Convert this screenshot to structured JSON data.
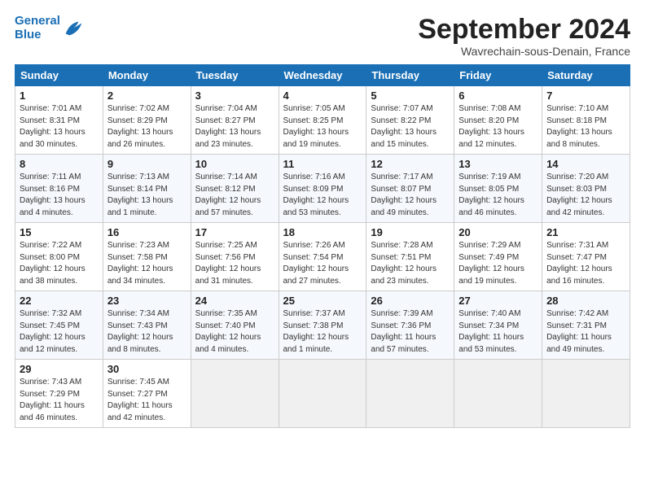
{
  "header": {
    "logo_line1": "General",
    "logo_line2": "Blue",
    "month_title": "September 2024",
    "subtitle": "Wavrechain-sous-Denain, France"
  },
  "weekdays": [
    "Sunday",
    "Monday",
    "Tuesday",
    "Wednesday",
    "Thursday",
    "Friday",
    "Saturday"
  ],
  "weeks": [
    [
      {
        "day": "1",
        "info": "Sunrise: 7:01 AM\nSunset: 8:31 PM\nDaylight: 13 hours\nand 30 minutes."
      },
      {
        "day": "2",
        "info": "Sunrise: 7:02 AM\nSunset: 8:29 PM\nDaylight: 13 hours\nand 26 minutes."
      },
      {
        "day": "3",
        "info": "Sunrise: 7:04 AM\nSunset: 8:27 PM\nDaylight: 13 hours\nand 23 minutes."
      },
      {
        "day": "4",
        "info": "Sunrise: 7:05 AM\nSunset: 8:25 PM\nDaylight: 13 hours\nand 19 minutes."
      },
      {
        "day": "5",
        "info": "Sunrise: 7:07 AM\nSunset: 8:22 PM\nDaylight: 13 hours\nand 15 minutes."
      },
      {
        "day": "6",
        "info": "Sunrise: 7:08 AM\nSunset: 8:20 PM\nDaylight: 13 hours\nand 12 minutes."
      },
      {
        "day": "7",
        "info": "Sunrise: 7:10 AM\nSunset: 8:18 PM\nDaylight: 13 hours\nand 8 minutes."
      }
    ],
    [
      {
        "day": "8",
        "info": "Sunrise: 7:11 AM\nSunset: 8:16 PM\nDaylight: 13 hours\nand 4 minutes."
      },
      {
        "day": "9",
        "info": "Sunrise: 7:13 AM\nSunset: 8:14 PM\nDaylight: 13 hours\nand 1 minute."
      },
      {
        "day": "10",
        "info": "Sunrise: 7:14 AM\nSunset: 8:12 PM\nDaylight: 12 hours\nand 57 minutes."
      },
      {
        "day": "11",
        "info": "Sunrise: 7:16 AM\nSunset: 8:09 PM\nDaylight: 12 hours\nand 53 minutes."
      },
      {
        "day": "12",
        "info": "Sunrise: 7:17 AM\nSunset: 8:07 PM\nDaylight: 12 hours\nand 49 minutes."
      },
      {
        "day": "13",
        "info": "Sunrise: 7:19 AM\nSunset: 8:05 PM\nDaylight: 12 hours\nand 46 minutes."
      },
      {
        "day": "14",
        "info": "Sunrise: 7:20 AM\nSunset: 8:03 PM\nDaylight: 12 hours\nand 42 minutes."
      }
    ],
    [
      {
        "day": "15",
        "info": "Sunrise: 7:22 AM\nSunset: 8:00 PM\nDaylight: 12 hours\nand 38 minutes."
      },
      {
        "day": "16",
        "info": "Sunrise: 7:23 AM\nSunset: 7:58 PM\nDaylight: 12 hours\nand 34 minutes."
      },
      {
        "day": "17",
        "info": "Sunrise: 7:25 AM\nSunset: 7:56 PM\nDaylight: 12 hours\nand 31 minutes."
      },
      {
        "day": "18",
        "info": "Sunrise: 7:26 AM\nSunset: 7:54 PM\nDaylight: 12 hours\nand 27 minutes."
      },
      {
        "day": "19",
        "info": "Sunrise: 7:28 AM\nSunset: 7:51 PM\nDaylight: 12 hours\nand 23 minutes."
      },
      {
        "day": "20",
        "info": "Sunrise: 7:29 AM\nSunset: 7:49 PM\nDaylight: 12 hours\nand 19 minutes."
      },
      {
        "day": "21",
        "info": "Sunrise: 7:31 AM\nSunset: 7:47 PM\nDaylight: 12 hours\nand 16 minutes."
      }
    ],
    [
      {
        "day": "22",
        "info": "Sunrise: 7:32 AM\nSunset: 7:45 PM\nDaylight: 12 hours\nand 12 minutes."
      },
      {
        "day": "23",
        "info": "Sunrise: 7:34 AM\nSunset: 7:43 PM\nDaylight: 12 hours\nand 8 minutes."
      },
      {
        "day": "24",
        "info": "Sunrise: 7:35 AM\nSunset: 7:40 PM\nDaylight: 12 hours\nand 4 minutes."
      },
      {
        "day": "25",
        "info": "Sunrise: 7:37 AM\nSunset: 7:38 PM\nDaylight: 12 hours\nand 1 minute."
      },
      {
        "day": "26",
        "info": "Sunrise: 7:39 AM\nSunset: 7:36 PM\nDaylight: 11 hours\nand 57 minutes."
      },
      {
        "day": "27",
        "info": "Sunrise: 7:40 AM\nSunset: 7:34 PM\nDaylight: 11 hours\nand 53 minutes."
      },
      {
        "day": "28",
        "info": "Sunrise: 7:42 AM\nSunset: 7:31 PM\nDaylight: 11 hours\nand 49 minutes."
      }
    ],
    [
      {
        "day": "29",
        "info": "Sunrise: 7:43 AM\nSunset: 7:29 PM\nDaylight: 11 hours\nand 46 minutes."
      },
      {
        "day": "30",
        "info": "Sunrise: 7:45 AM\nSunset: 7:27 PM\nDaylight: 11 hours\nand 42 minutes."
      },
      {
        "day": "",
        "info": ""
      },
      {
        "day": "",
        "info": ""
      },
      {
        "day": "",
        "info": ""
      },
      {
        "day": "",
        "info": ""
      },
      {
        "day": "",
        "info": ""
      }
    ]
  ]
}
